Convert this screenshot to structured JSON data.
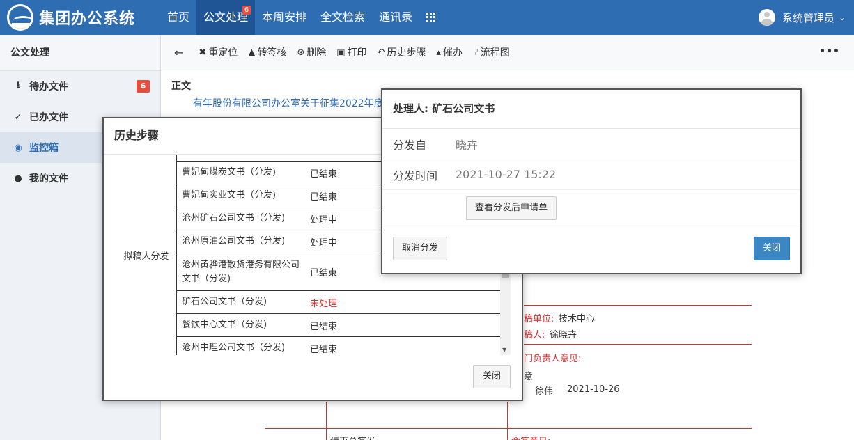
{
  "header": {
    "brand": "集团办公系统",
    "nav": [
      {
        "label": "首页"
      },
      {
        "label": "公文处理",
        "badge": "6"
      },
      {
        "label": "本周安排"
      },
      {
        "label": "全文检索"
      },
      {
        "label": "通讯录"
      }
    ],
    "user_name": "系统管理员"
  },
  "sidebar": {
    "title": "公文处理",
    "items": [
      {
        "label": "待办文件",
        "icon": "inbox-icon",
        "badge": "6"
      },
      {
        "label": "已办文件",
        "icon": "check-icon"
      },
      {
        "label": "监控箱",
        "icon": "eye-icon"
      },
      {
        "label": "我的文件",
        "icon": "user-icon"
      }
    ]
  },
  "toolbar": {
    "items": [
      {
        "label": "重定位",
        "icon": "relocate-icon"
      },
      {
        "label": "转签核",
        "icon": "person-icon"
      },
      {
        "label": "删除",
        "icon": "delete-icon"
      },
      {
        "label": "打印",
        "icon": "print-icon"
      },
      {
        "label": "历史步骤",
        "icon": "history-icon"
      },
      {
        "label": "催办",
        "icon": "bell-icon"
      },
      {
        "label": "流程图",
        "icon": "flow-icon"
      }
    ]
  },
  "document": {
    "section_label": "正文",
    "title_link": "有年股份有限公司办公室关于征集2022年度",
    "form": {
      "unit_label": "稿单位:",
      "unit_value": "技术中心",
      "drafter_label": "稿人:",
      "drafter_value": "徐晓卉",
      "dept_opinion_label": "门负责人意见:",
      "opinion_value": "意",
      "signer": "徐伟",
      "sign_date": "2021-10-26",
      "bottom_left": "请再总签发",
      "bottom_right": "会签意见:"
    }
  },
  "history_modal": {
    "title": "历史步骤",
    "group_label": "拟稿人分发",
    "rows": [
      {
        "name": "曹妃甸煤炭文书（分发)",
        "status": "已结束",
        "status_color": "#333333"
      },
      {
        "name": "曹妃甸实业文书（分发)",
        "status": "已结束",
        "status_color": "#333333"
      },
      {
        "name": "沧州矿石公司文书（分发)",
        "status": "处理中",
        "status_color": "#333333"
      },
      {
        "name": "沧州原油公司文书（分发)",
        "status": "处理中",
        "status_color": "#333333"
      },
      {
        "name": "沧州黄骅港散货港务有限公司文书（分发)",
        "status": "已结束",
        "status_color": "#333333"
      },
      {
        "name": "矿石公司文书（分发)",
        "status": "未处理",
        "status_color": "#d63131"
      },
      {
        "name": "餐饮中心文书（分发)",
        "status": "已结束",
        "status_color": "#333333"
      },
      {
        "name": "沧州中理公司文书（分发)",
        "status": "已结束",
        "status_color": "#333333"
      }
    ],
    "close_label": "关闭"
  },
  "handler_modal": {
    "title": "处理人:  矿石公司文书",
    "from_label": "分发自",
    "from_value": "晓卉",
    "time_label": "分发时间",
    "time_value": "2021-10-27 15:22",
    "view_button": "查看分发后申请单",
    "cancel_button": "取消分发",
    "close_button": "关闭"
  },
  "colors": {
    "header_bg": "#2f6db3",
    "badge": "#e74c3c",
    "primary_button": "#3a87c4",
    "alert_text": "#d63131"
  }
}
